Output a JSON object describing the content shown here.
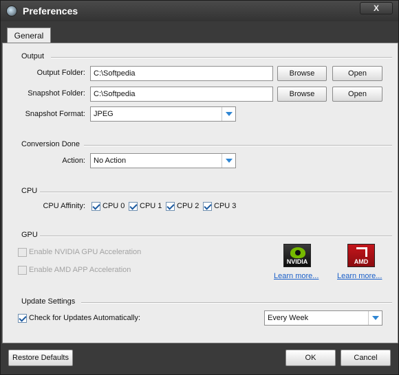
{
  "window": {
    "title": "Preferences",
    "close_label": "X"
  },
  "tabs": [
    {
      "label": "General"
    }
  ],
  "output": {
    "group_label": "Output",
    "output_folder_label": "Output Folder:",
    "output_folder_value": "C:\\Softpedia",
    "snapshot_folder_label": "Snapshot Folder:",
    "snapshot_folder_value": "C:\\Softpedia",
    "snapshot_format_label": "Snapshot Format:",
    "snapshot_format_value": "JPEG",
    "browse_label": "Browse",
    "open_label": "Open"
  },
  "conversion_done": {
    "group_label": "Conversion Done",
    "action_label": "Action:",
    "action_value": "No Action"
  },
  "cpu": {
    "group_label": "CPU",
    "affinity_label": "CPU Affinity:",
    "cores": [
      {
        "label": "CPU 0",
        "checked": true
      },
      {
        "label": "CPU 1",
        "checked": true
      },
      {
        "label": "CPU 2",
        "checked": true
      },
      {
        "label": "CPU 3",
        "checked": true
      }
    ]
  },
  "gpu": {
    "group_label": "GPU",
    "nvidia_label": "Enable NVIDIA GPU Acceleration",
    "nvidia_checked": false,
    "amd_label": "Enable AMD APP Acceleration",
    "amd_checked": false,
    "nvidia_logo_text": "NVIDIA",
    "amd_logo_text": "AMD",
    "learn_more_nvidia": "Learn more...",
    "learn_more_amd": "Learn more..."
  },
  "update": {
    "group_label": "Update Settings",
    "check_label": "Check for Updates Automatically:",
    "check_checked": true,
    "frequency_value": "Every Week"
  },
  "footer": {
    "restore_label": "Restore Defaults",
    "ok_label": "OK",
    "cancel_label": "Cancel"
  },
  "colors": {
    "accent": "#2f86d3",
    "link": "#1a5fc8",
    "nvidia_green": "#76b900",
    "amd_red": "#c4161c",
    "frame": "#3a3a3a",
    "panel": "#ececec"
  }
}
